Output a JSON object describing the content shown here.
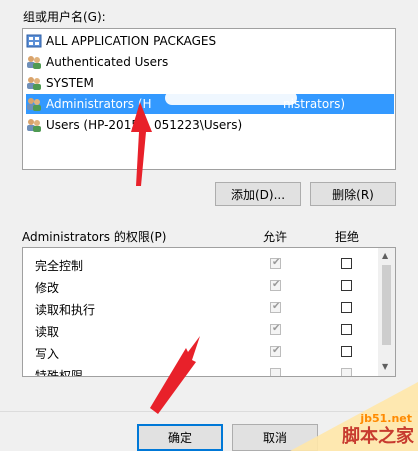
{
  "group": {
    "label": "组或用户名(G):",
    "users": [
      {
        "name": "ALL APPLICATION PACKAGES",
        "icon": "app-packages-icon",
        "selected": false
      },
      {
        "name": "Authenticated Users",
        "icon": "users-group-icon",
        "selected": false
      },
      {
        "name": "SYSTEM",
        "icon": "users-group-icon",
        "selected": false
      },
      {
        "name": "Administrators (H",
        "name_suffix": "nistrators)",
        "icon": "users-group-icon",
        "selected": true
      },
      {
        "name": "Users (HP-2015",
        "name_suffix": "051223\\Users)",
        "icon": "users-group-icon",
        "selected": false
      }
    ]
  },
  "buttons": {
    "add": "添加(D)...",
    "remove": "删除(R)",
    "ok": "确定",
    "cancel": "取消"
  },
  "permissions": {
    "title": "Administrators 的权限(P)",
    "allow_header": "允许",
    "deny_header": "拒绝",
    "rows": [
      {
        "name": "完全控制",
        "allow": true,
        "deny": false
      },
      {
        "name": "修改",
        "allow": true,
        "deny": false
      },
      {
        "name": "读取和执行",
        "allow": true,
        "deny": false
      },
      {
        "name": "读取",
        "allow": true,
        "deny": false
      },
      {
        "name": "写入",
        "allow": true,
        "deny": false
      },
      {
        "name": "特殊权限",
        "allow": false,
        "deny": false
      }
    ]
  },
  "watermark": {
    "site": "jb51.net",
    "brand": "脚本之家"
  },
  "colors": {
    "selection": "#3399ff",
    "annotation_arrow": "#e8212a",
    "primary_border": "#0078d7"
  }
}
